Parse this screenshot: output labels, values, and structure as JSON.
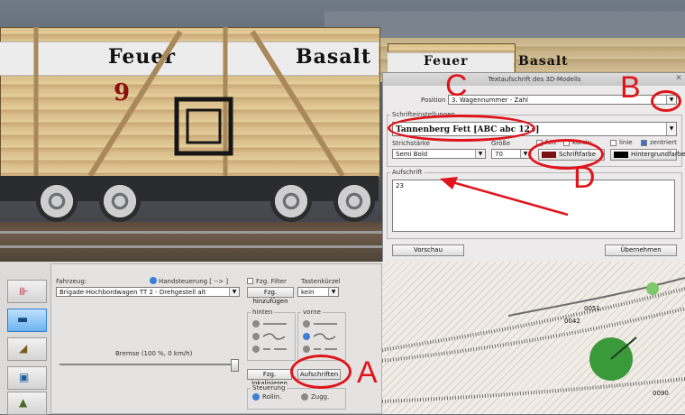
{
  "scene": {
    "wagon_left_text_1": "Feuer",
    "wagon_left_text_2": "Basalt",
    "wagon_left_number": "9",
    "wagon_right_text_1": "Feuer",
    "wagon_right_text_2": "Basalt"
  },
  "dialog": {
    "title": "Textaufschrift des 3D-Modells",
    "wagon_number_field": {
      "label": "Position",
      "value": "3. Wagennummer - Zahl"
    },
    "font_settings_group": "Schrifteinstellungen",
    "font_select_value": "Tannenberg Fett [ABC abc 123]",
    "style_label": "Strichstärke",
    "style_value": "Semi Bold",
    "size_label": "Größe",
    "size_value": "70",
    "checkboxes": [
      {
        "label": "fett",
        "checked": false
      },
      {
        "label": "kursiv",
        "checked": false
      },
      {
        "label": "linie",
        "checked": false
      },
      {
        "label": "zentriert",
        "checked": true
      }
    ],
    "font_color_button": "Schriftfarbe",
    "font_color_swatch": "#7a0f0f",
    "bg_color_button": "Hintergrundfarbe",
    "bg_color_swatch": "#000000",
    "inscription_group": "Aufschrift",
    "inscription_value": "23",
    "preview_button": "Vorschau",
    "apply_button": "Übernehmen"
  },
  "annotations": {
    "A": "A",
    "B": "B",
    "C": "C",
    "D": "D",
    "color": "#e0141b"
  },
  "panel": {
    "vehicle_label": "Fahrzeug:",
    "manual_control_label": "Handsteuerung [ --> ]",
    "vehicle_value": "Brigade-Hochbordwagen TT 2 - Drehgestell alt",
    "filter_label": "Fzg. Filter",
    "key_label": "Tastenkürzel",
    "add_vehicle_button": "Fzg. hinzufügen",
    "key_value": "kein",
    "rear_group": "hinten",
    "front_group": "vorne",
    "brake_label": "Bremse (100 %, 0 km/h)",
    "locate_button": "Fzg. lokalisieren",
    "inscriptions_button": "Aufschriften",
    "control_group": "Steuerung",
    "rolling_label": "Rollin.",
    "train_label": "Zugg."
  },
  "map": {
    "labels": [
      "0051",
      "0042",
      "0090"
    ]
  }
}
